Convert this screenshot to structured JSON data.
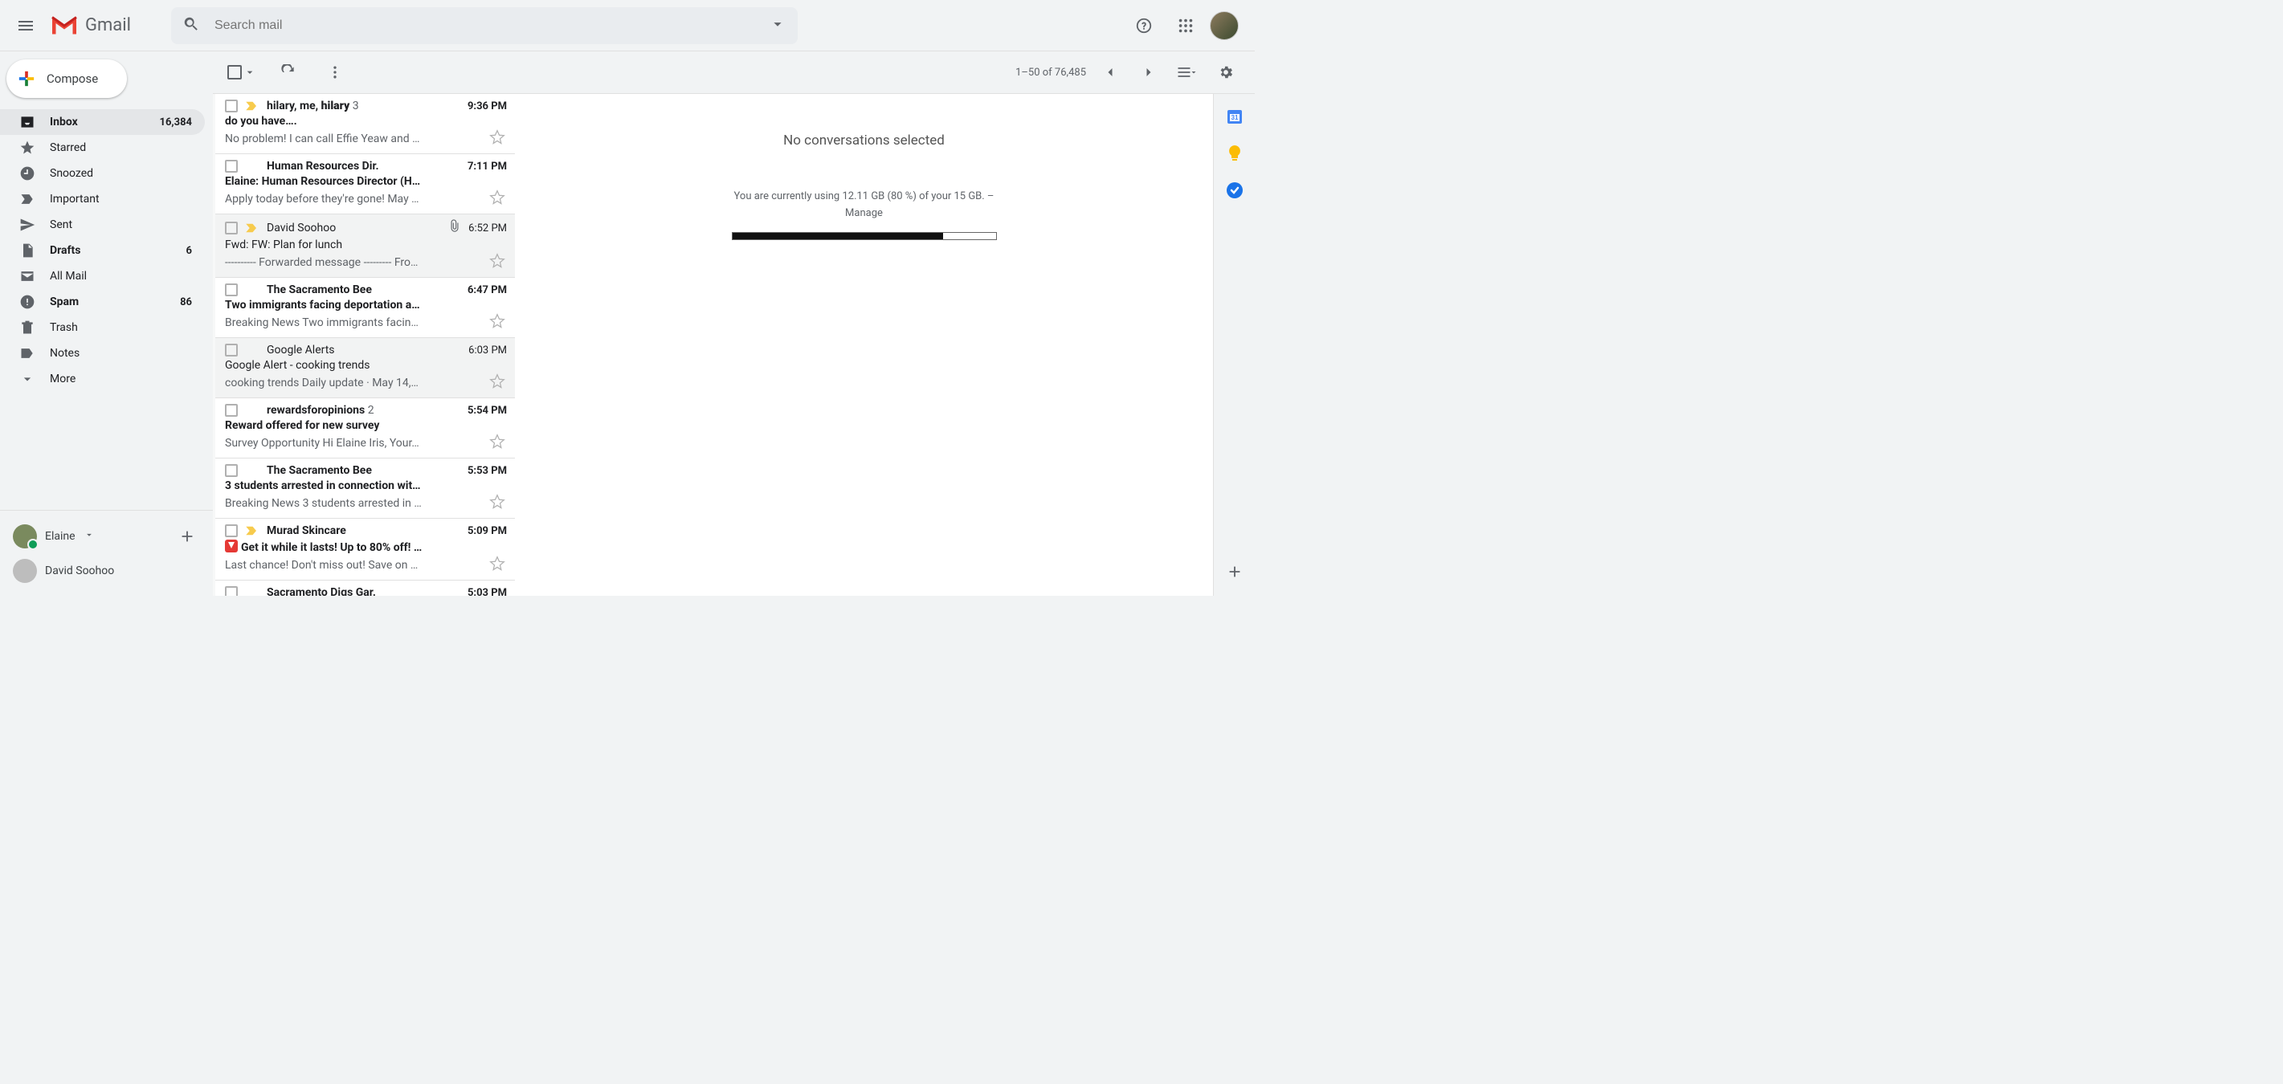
{
  "header": {
    "product": "Gmail",
    "search_placeholder": "Search mail"
  },
  "compose_label": "Compose",
  "sidebar": [
    {
      "id": "inbox",
      "label": "Inbox",
      "count": "16,384",
      "icon": "inbox",
      "bold": true,
      "selected": true
    },
    {
      "id": "starred",
      "label": "Starred",
      "count": "",
      "icon": "star",
      "bold": false
    },
    {
      "id": "snoozed",
      "label": "Snoozed",
      "count": "",
      "icon": "clock",
      "bold": false
    },
    {
      "id": "important",
      "label": "Important",
      "count": "",
      "icon": "important",
      "bold": false
    },
    {
      "id": "sent",
      "label": "Sent",
      "count": "",
      "icon": "sent",
      "bold": false
    },
    {
      "id": "drafts",
      "label": "Drafts",
      "count": "6",
      "icon": "draft",
      "bold": true
    },
    {
      "id": "allmail",
      "label": "All Mail",
      "count": "",
      "icon": "allmail",
      "bold": false
    },
    {
      "id": "spam",
      "label": "Spam",
      "count": "86",
      "icon": "spam",
      "bold": true
    },
    {
      "id": "trash",
      "label": "Trash",
      "count": "",
      "icon": "trash",
      "bold": false
    },
    {
      "id": "notes",
      "label": "Notes",
      "count": "",
      "icon": "label",
      "bold": false
    },
    {
      "id": "more",
      "label": "More",
      "count": "",
      "icon": "expand",
      "bold": false
    }
  ],
  "hangouts": {
    "me": "Elaine",
    "contacts": [
      "David Soohoo"
    ]
  },
  "toolbar": {
    "range": "1–50 of 76,485"
  },
  "messages": [
    {
      "sender": "hilary, me, <b>hilary</b>",
      "thread": "3",
      "time": "9:36 PM",
      "subject": "do you have….",
      "snippet": "No problem! I can call Effie Yeaw and …",
      "unread": true,
      "important": true,
      "attachment": false,
      "current": true,
      "read": false
    },
    {
      "sender": "Human Resources Dir.",
      "thread": "",
      "time": "7:11 PM",
      "subject": "Elaine: Human Resources Director (H…",
      "snippet": "Apply today before they're gone! May …",
      "unread": true,
      "important": false,
      "attachment": false,
      "read": false
    },
    {
      "sender": "David Soohoo",
      "thread": "",
      "time": "6:52 PM",
      "subject": "Fwd: FW: Plan for lunch",
      "snippet": "---------- Forwarded message --------- Fro…",
      "unread": false,
      "important": true,
      "attachment": true,
      "read": true
    },
    {
      "sender": "The Sacramento Bee",
      "thread": "",
      "time": "6:47 PM",
      "subject": "Two immigrants facing deportation a…",
      "snippet": "Breaking News Two immigrants facin…",
      "unread": true,
      "important": false,
      "attachment": false,
      "read": false
    },
    {
      "sender": "Google Alerts",
      "thread": "",
      "time": "6:03 PM",
      "subject": "Google Alert - cooking trends",
      "snippet": "cooking trends Daily update · May 14,…",
      "unread": false,
      "important": false,
      "attachment": false,
      "read": true
    },
    {
      "sender": "rewardsforopinions",
      "thread": "2",
      "time": "5:54 PM",
      "subject": "Reward offered for new survey",
      "snippet": "Survey Opportunity Hi Elaine Iris, Your…",
      "unread": true,
      "important": false,
      "attachment": false,
      "read": false
    },
    {
      "sender": "The Sacramento Bee",
      "thread": "",
      "time": "5:53 PM",
      "subject": "3 students arrested in connection wit…",
      "snippet": "Breaking News 3 students arrested in …",
      "unread": true,
      "important": false,
      "attachment": false,
      "read": false
    },
    {
      "sender": "Murad Skincare",
      "thread": "",
      "time": "5:09 PM",
      "subject": "Get it while it lasts! Up to 80% off! …",
      "snippet": "Last chance! Don't miss out! Save on …",
      "unread": true,
      "important": true,
      "attachment": false,
      "read": false,
      "emoji": true
    },
    {
      "sender": "Sacramento Digs Gar.",
      "thread": "",
      "time": "5:03 PM",
      "subject": "",
      "snippet": "",
      "unread": true,
      "important": false,
      "attachment": false,
      "read": false
    }
  ],
  "reading": {
    "empty": "No conversations selected",
    "storage_line": "You are currently using 12.11 GB (80 %) of your 15 GB. –",
    "manage": "Manage",
    "percent": 80
  }
}
